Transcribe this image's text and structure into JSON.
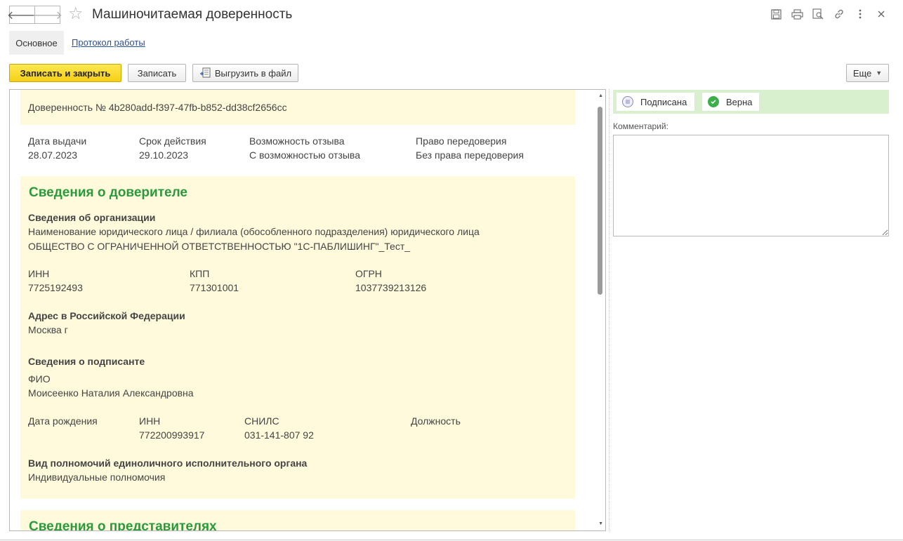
{
  "window": {
    "title": "Машиночитаемая доверенность"
  },
  "tabs": {
    "main": "Основное",
    "log": "Протокол работы"
  },
  "toolbar": {
    "save_close": "Записать и закрыть",
    "save": "Записать",
    "export": "Выгрузить в файл",
    "more": "Еще"
  },
  "doc": {
    "number": "Доверенность № 4b280add-f397-47fb-b852-dd38cf2656cc",
    "issue_date_label": "Дата выдачи",
    "issue_date": "28.07.2023",
    "validity_label": "Срок действия",
    "validity": "29.10.2023",
    "revoke_label": "Возможность отзыва",
    "revoke": "С возможностью отзыва",
    "transfer_label": "Право передоверия",
    "transfer": "Без права передоверия"
  },
  "principal": {
    "title": "Сведения о доверителе",
    "org_title": "Сведения об организации",
    "org_name_label": "Наименование юридического лица / филиала (обособленного подразделения) юридического лица",
    "org_name": "ОБЩЕСТВО С ОГРАНИЧЕННОЙ ОТВЕТСТВЕННОСТЬЮ \"1С-ПАБЛИШИНГ\"_Тест_",
    "inn_label": "ИНН",
    "inn": "7725192493",
    "kpp_label": "КПП",
    "kpp": "771301001",
    "ogrn_label": "ОГРН",
    "ogrn": "1037739213126",
    "address_title": "Адрес в Российской Федерации",
    "address": "Москва г",
    "signer_title": "Сведения о подписанте",
    "fio_label": "ФИО",
    "fio": "Моисеенко Наталия Александровна",
    "birth_label": "Дата рождения",
    "signer_inn_label": "ИНН",
    "signer_inn": "772200993917",
    "snils_label": "СНИЛС",
    "snils": "031-141-807 92",
    "position_label": "Должность",
    "authority_title": "Вид полномочий единоличного исполнительного органа",
    "authority": "Индивидуальные полномочия"
  },
  "representatives": {
    "title": "Сведения о представителях"
  },
  "status": {
    "signed": "Подписана",
    "valid": "Верна"
  },
  "comment": {
    "label": "Комментарий:"
  },
  "colors": {
    "accent_green": "#2a9a3c",
    "block_bg": "#fffadb",
    "primary_button": "#f5d017",
    "status_bar": "#d9f0cf"
  }
}
